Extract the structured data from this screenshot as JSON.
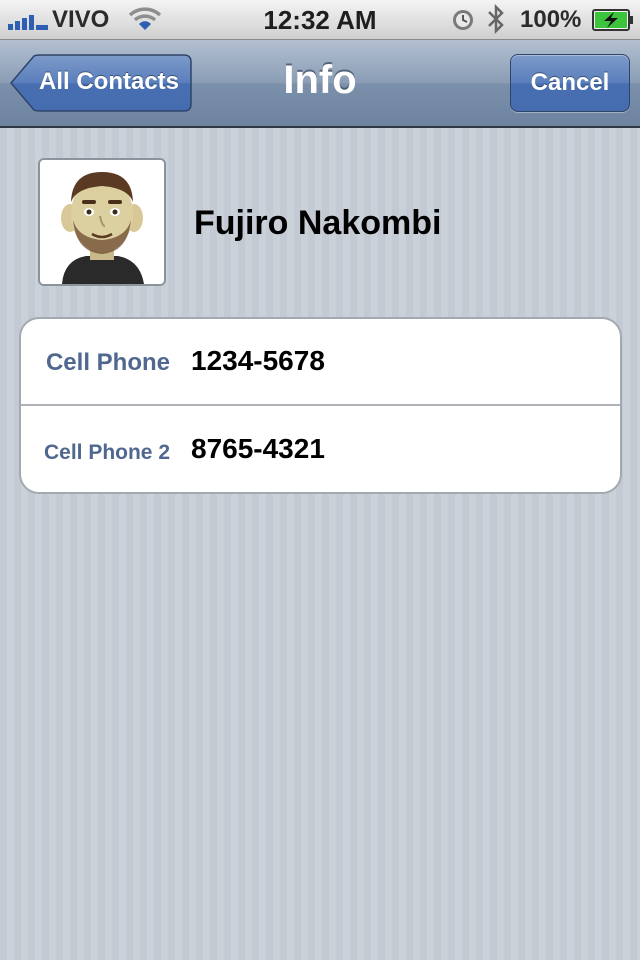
{
  "status_bar": {
    "carrier": "VIVO",
    "time": "12:32 AM",
    "battery_percent": "100%",
    "icons": [
      "signal-icon",
      "wifi-icon",
      "alarm-clock-icon",
      "bluetooth-icon",
      "battery-charging-icon"
    ]
  },
  "nav_bar": {
    "title": "Info",
    "back_label": "All Contacts",
    "cancel_label": "Cancel"
  },
  "contact": {
    "name": "Fujiro Nakombi",
    "avatar_icon": "avatar-cartoon-icon"
  },
  "phones": [
    {
      "label": "Cell Phone",
      "value": "1234-5678"
    },
    {
      "label": "Cell Phone 2",
      "value": "8765-4321"
    }
  ],
  "colors": {
    "nav_bar": "#7b90aa",
    "button_blue": "#486fb2",
    "label_blue": "#50688f",
    "background": "#c5ccd4"
  }
}
